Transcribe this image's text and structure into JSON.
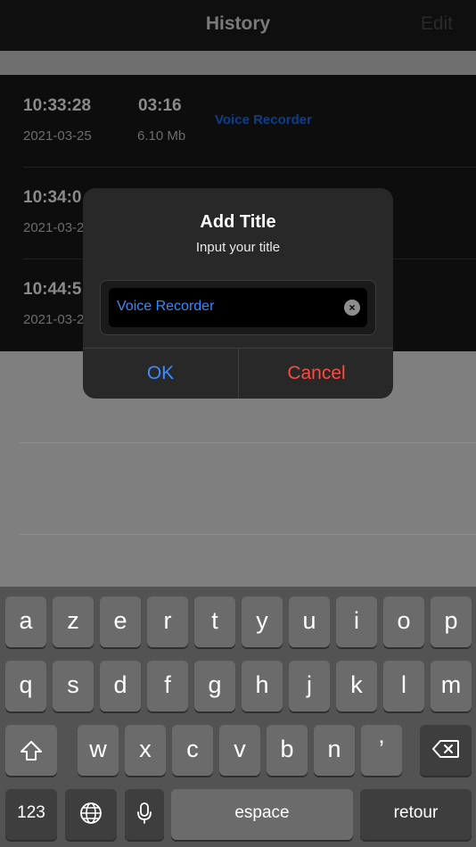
{
  "nav": {
    "title": "History",
    "edit_label": "Edit"
  },
  "recordings": [
    {
      "time": "10:33:28",
      "date": "2021-03-25",
      "duration": "03:16",
      "size": "6.10 Mb",
      "name": "Voice Recorder"
    },
    {
      "time": "10:34:0",
      "date": "2021-03-2"
    },
    {
      "time": "10:44:5",
      "date": "2021-03-2"
    }
  ],
  "dialog": {
    "title": "Add Title",
    "message": "Input your title",
    "input_value": "Voice Recorder",
    "ok_label": "OK",
    "cancel_label": "Cancel"
  },
  "keyboard": {
    "row1": [
      "a",
      "z",
      "e",
      "r",
      "t",
      "y",
      "u",
      "i",
      "o",
      "p"
    ],
    "row2": [
      "q",
      "s",
      "d",
      "f",
      "g",
      "h",
      "j",
      "k",
      "l",
      "m"
    ],
    "row3": [
      "w",
      "x",
      "c",
      "v",
      "b",
      "n",
      "’"
    ],
    "numbers_label": "123",
    "space_label": "espace",
    "return_label": "retour",
    "icons": [
      "shift-icon",
      "backspace-icon",
      "globe-icon",
      "microphone-icon"
    ]
  },
  "colors": {
    "accent_blue": "#3d8bff",
    "cancel_red": "#ff4a3d",
    "input_text": "#2f8cff"
  }
}
